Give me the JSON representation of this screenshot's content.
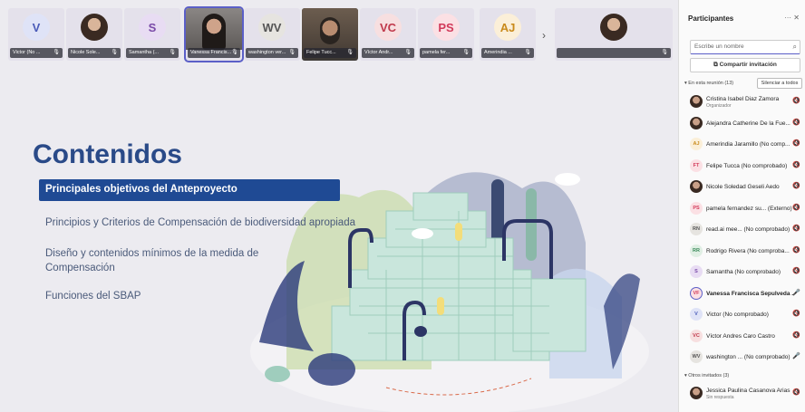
{
  "video_strip": {
    "tiles": [
      {
        "initials": "V",
        "name": "Victor (No ...",
        "bg": "#dfe3f7",
        "fg": "#4a5bb8",
        "type": "initials"
      },
      {
        "initials": "",
        "name": "Nicole Sole...",
        "type": "photo"
      },
      {
        "initials": "S",
        "name": "Samantha (...",
        "bg": "#e8dcf3",
        "fg": "#7a4aa8",
        "type": "initials"
      },
      {
        "initials": "",
        "name": "Vanessa Francis...",
        "type": "camera-woman",
        "active": true
      },
      {
        "initials": "WV",
        "name": "washington ver...",
        "bg": "#e6e4e0",
        "fg": "#555",
        "type": "initials"
      },
      {
        "initials": "",
        "name": "Felipe Tucc...",
        "type": "camera-man"
      },
      {
        "initials": "VC",
        "name": "Víctor Andr...",
        "bg": "#f7dfe0",
        "fg": "#c0394b",
        "type": "initials"
      },
      {
        "initials": "PS",
        "name": "pamela fer...",
        "bg": "#fbe0e4",
        "fg": "#d23a5a",
        "type": "initials"
      },
      {
        "initials": "AJ",
        "name": "Amerindia ...",
        "bg": "#fbefd8",
        "fg": "#c98a1a",
        "type": "initials"
      },
      {
        "initials": "",
        "name": "",
        "type": "photo"
      }
    ]
  },
  "slide": {
    "title": "Contenidos",
    "items": [
      "Principales objetivos del Anteproyecto",
      "Principios y Criterios de Compensación de biodiversidad apropiada",
      "Diseño y contenidos mínimos de la medida de Compensación",
      "Funciones del SBAP"
    ]
  },
  "panel": {
    "title": "Participantes",
    "icons": "··· ✕",
    "search_placeholder": "Escribe un nombre",
    "share_label": "Compartir invitación",
    "in_meeting_label": "▾ En esta reunión (13)",
    "mute_all_label": "Silenciar a todos",
    "others_label": "▾ Otros invitados (3)",
    "participants": [
      {
        "name": "Cristina Isabel Diaz Zamora",
        "sub": "Organizador",
        "avatar": "img"
      },
      {
        "name": "Alejandra Catherine De la Fue...",
        "avatar": "img"
      },
      {
        "name": "Amerindia Jaramillo (No comp...",
        "initials": "AJ",
        "bg": "#fbefd8",
        "fg": "#c98a1a"
      },
      {
        "name": "Felipe Tucca (No comprobado)",
        "initials": "FT",
        "bg": "#fbe0e4",
        "fg": "#d23a5a"
      },
      {
        "name": "Nicole Soledad Geseli Aedo",
        "avatar": "img"
      },
      {
        "name": "pamela fernandez su... (Externo)",
        "initials": "PS",
        "bg": "#fbe0e4",
        "fg": "#d23a5a"
      },
      {
        "name": "read.ai mee... (No comprobado)",
        "initials": "RN",
        "bg": "#e6e4e0",
        "fg": "#555"
      },
      {
        "name": "Rodrigo Rivera (No comproba...",
        "initials": "RR",
        "bg": "#e0efe4",
        "fg": "#3a8a5a"
      },
      {
        "name": "Samantha (No comprobado)",
        "initials": "S",
        "bg": "#e8dcf3",
        "fg": "#7a4aa8"
      },
      {
        "name": "Vanessa Francisca Sepulveda ...",
        "initials": "VF",
        "bg": "#fbe0e4",
        "fg": "#d23a5a",
        "bold": true,
        "ring": true,
        "mic_on": true
      },
      {
        "name": "Victor (No comprobado)",
        "initials": "V",
        "bg": "#dfe3f7",
        "fg": "#4a5bb8"
      },
      {
        "name": "Víctor Andres Caro Castro",
        "initials": "VC",
        "bg": "#f7dfe0",
        "fg": "#c0394b"
      },
      {
        "name": "washington ... (No comprobado)",
        "initials": "WV",
        "bg": "#e6e4e0",
        "fg": "#555",
        "mic_on": true
      }
    ],
    "others": [
      {
        "name": "Jessica Paulina Casanova Arias",
        "sub": "Sin respuesta",
        "avatar": "img"
      }
    ]
  },
  "colors": {
    "accent": "#5b5fc7",
    "slide_title": "#2a4a88",
    "highlight": "#1f4a94"
  }
}
